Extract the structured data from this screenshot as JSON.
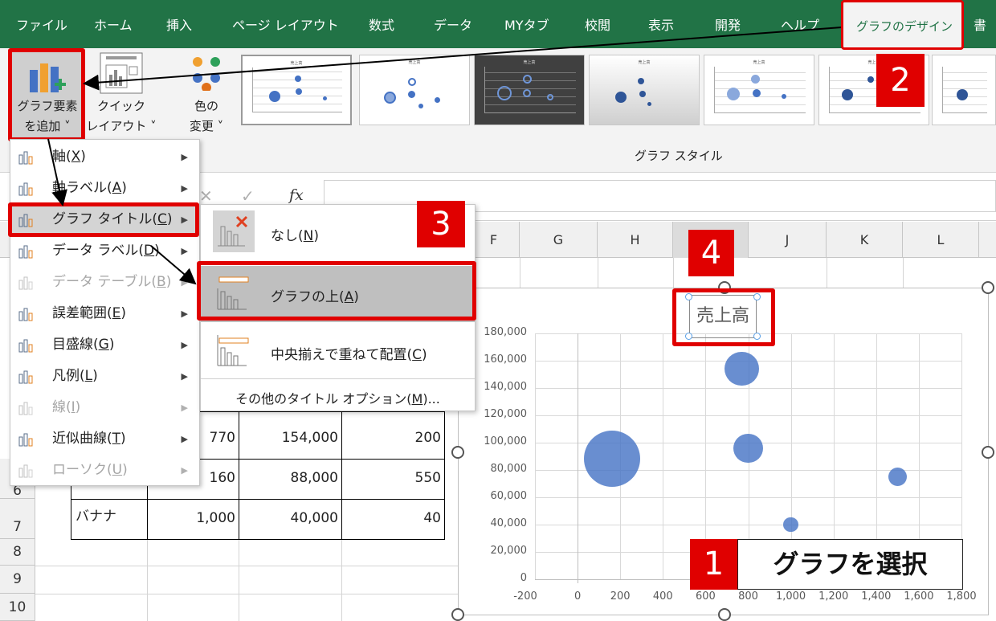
{
  "ribbon": {
    "tabs": [
      "ファイル",
      "ホーム",
      "挿入",
      "ページ レイアウト",
      "数式",
      "データ",
      "MYタブ",
      "校閲",
      "表示",
      "開発",
      "ヘルプ",
      "グラフのデザイン",
      "書"
    ],
    "active_tab": "グラフのデザイン",
    "add_element_label_1": "グラフ要素",
    "add_element_label_2": "を追加 ˅",
    "quick_layout_label_1": "クイック",
    "quick_layout_label_2": "レイアウト ˅",
    "change_color_label_1": "色の",
    "change_color_label_2": "変更 ˅",
    "styles_group_label": "グラフ スタイル"
  },
  "formula_bar": {
    "fx": "fx",
    "cancel": "✕",
    "enter": "✓"
  },
  "columns": [
    "F",
    "G",
    "H",
    "I",
    "J",
    "K",
    "L"
  ],
  "rows": [
    "6",
    "7",
    "8",
    "9",
    "10"
  ],
  "table": {
    "row5": [
      "770",
      "154,000",
      "200"
    ],
    "row6": [
      "160",
      "88,000",
      "550"
    ],
    "row7": [
      "バナナ",
      "1,000",
      "40,000",
      "40"
    ]
  },
  "menu": {
    "items": [
      {
        "label": "軸(",
        "key": "X",
        "tail": ")",
        "enabled": true
      },
      {
        "label": "軸ラベル(",
        "key": "A",
        "tail": ")",
        "enabled": true
      },
      {
        "label": "グラフ タイトル(",
        "key": "C",
        "tail": ")",
        "enabled": true
      },
      {
        "label": "データ ラベル(",
        "key": "D",
        "tail": ")",
        "enabled": true
      },
      {
        "label": "データ テーブル(",
        "key": "B",
        "tail": ")",
        "enabled": false
      },
      {
        "label": "誤差範囲(",
        "key": "E",
        "tail": ")",
        "enabled": true
      },
      {
        "label": "目盛線(",
        "key": "G",
        "tail": ")",
        "enabled": true
      },
      {
        "label": "凡例(",
        "key": "L",
        "tail": ")",
        "enabled": true
      },
      {
        "label": "線(",
        "key": "I",
        "tail": ")",
        "enabled": false
      },
      {
        "label": "近似曲線(",
        "key": "T",
        "tail": ")",
        "enabled": true
      },
      {
        "label": "ローソク(",
        "key": "U",
        "tail": ")",
        "enabled": false
      }
    ]
  },
  "submenu": {
    "none": {
      "label": "なし(",
      "key": "N",
      "tail": ")"
    },
    "above": {
      "label": "グラフの上(",
      "key": "A",
      "tail": ")"
    },
    "centered": {
      "label": "中央揃えで重ねて配置(",
      "key": "C",
      "tail": ")"
    },
    "more": {
      "label": "その他のタイトル オプション(",
      "key": "M",
      "tail": ")..."
    }
  },
  "chart": {
    "title": "売上高"
  },
  "chart_data": {
    "type": "scatter",
    "title": "売上高",
    "xlim": [
      -200,
      1800
    ],
    "ylim": [
      0,
      180000
    ],
    "x_ticks": [
      "-200",
      "0",
      "200",
      "400",
      "600",
      "800",
      "1,000",
      "1,200",
      "1,400",
      "1,600",
      "1,800"
    ],
    "y_ticks": [
      "0",
      "20,000",
      "40,000",
      "60,000",
      "80,000",
      "100,000",
      "120,000",
      "140,000",
      "160,000",
      "180,000"
    ],
    "points": [
      {
        "x": 160,
        "y": 88000,
        "size": 550
      },
      {
        "x": 770,
        "y": 154000,
        "size": 200
      },
      {
        "x": 800,
        "y": 96000,
        "size": 150
      },
      {
        "x": 1500,
        "y": 75000,
        "size": 60
      },
      {
        "x": 1000,
        "y": 40000,
        "size": 40
      }
    ]
  },
  "callouts": {
    "c1": "1",
    "c1_text": "グラフを選択",
    "c2": "2",
    "c3": "3",
    "c4": "4"
  },
  "colors": {
    "excel_green": "#217346",
    "accent_red": "#e00000",
    "bubble_blue": "#4472c4"
  }
}
